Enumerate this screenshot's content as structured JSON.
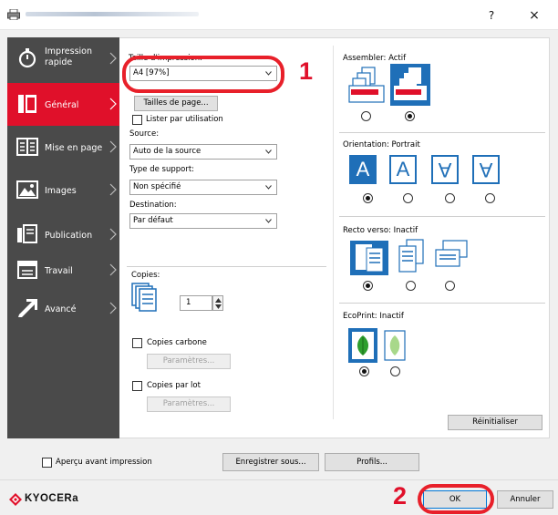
{
  "titlebar": {
    "help": "?",
    "close": "×"
  },
  "sidebar": {
    "items": [
      {
        "label": "Impression rapide",
        "label_l1": "Impression",
        "label_l2": "rapide",
        "icon": "stopwatch-icon"
      },
      {
        "label": "Général",
        "icon": "general-document-icon"
      },
      {
        "label": "Mise en page",
        "icon": "layout-icon"
      },
      {
        "label": "Images",
        "icon": "image-icon"
      },
      {
        "label": "Publication",
        "icon": "publication-icon"
      },
      {
        "label": "Travail",
        "icon": "job-icon"
      },
      {
        "label": "Avancé",
        "icon": "advanced-arrow-icon"
      }
    ],
    "active": "Général"
  },
  "general": {
    "paper_size_label": "Taille d'impression:",
    "paper_size_value": "A4  [97%]",
    "paper_sizes_button": "Tailles de page...",
    "list_by_usage_label": "Lister par utilisation",
    "source_label": "Source:",
    "source_value": "Auto de la source",
    "media_type_label": "Type de support:",
    "media_type_value": "Non spécifié",
    "destination_label": "Destination:",
    "destination_value": "Par défaut",
    "copies_label": "Copies:",
    "copies_value": "1",
    "carbon_copies_label": "Copies carbone",
    "carbon_settings_button": "Paramètres...",
    "job_copies_label": "Copies par lot",
    "job_settings_button": "Paramètres...",
    "collate_label": "Assembler:  Actif",
    "orientation_label": "Orientation:  Portrait",
    "orientation_glyph": "A",
    "duplex_label": "Recto verso:  Inactif",
    "ecoprint_label": "EcoPrint:  Inactif",
    "reset_button": "Réinitialiser"
  },
  "callouts": {
    "step1": "1",
    "step2": "2"
  },
  "footer": {
    "preview_label": "Aperçu avant impression",
    "save_as_button": "Enregistrer sous...",
    "profiles_button": "Profils...",
    "ok_button": "OK",
    "cancel_button": "Annuler"
  },
  "brand": {
    "name": "KYOCERa",
    "accent": "#e0102a",
    "blue": "#1f6fb8",
    "sidebar_bg": "#4a4a4a"
  }
}
